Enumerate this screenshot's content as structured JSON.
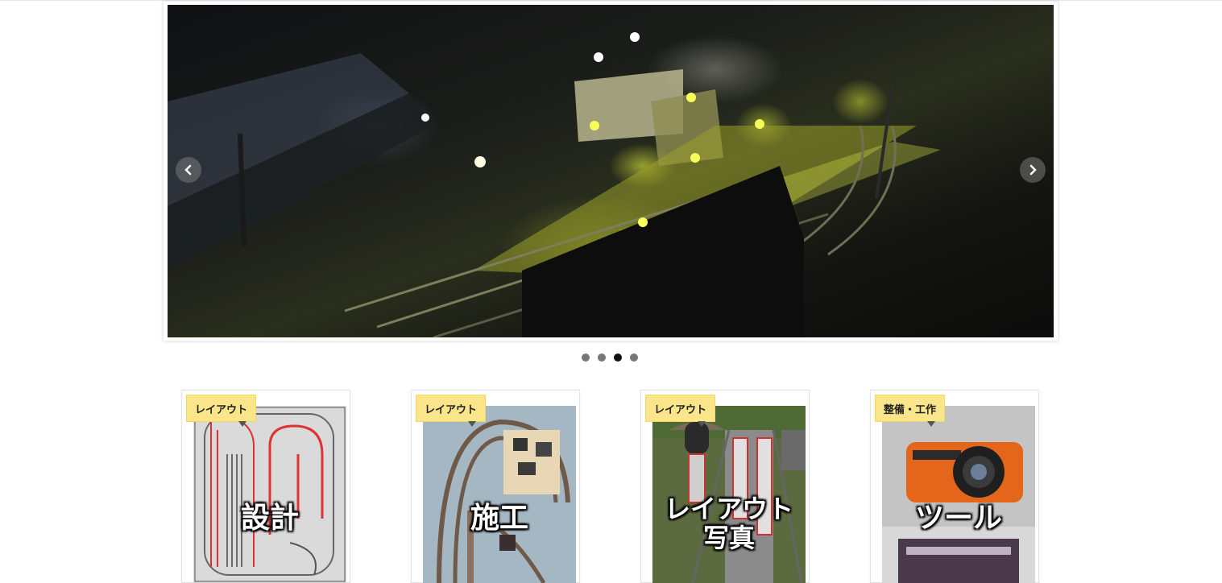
{
  "slider": {
    "prev_icon": "chevron-left-icon",
    "next_icon": "chevron-right-icon",
    "dots": [
      {
        "active": false
      },
      {
        "active": false
      },
      {
        "active": true
      },
      {
        "active": false
      }
    ]
  },
  "cards": [
    {
      "tag": "レイアウト",
      "title": "設計"
    },
    {
      "tag": "レイアウト",
      "title": "施工"
    },
    {
      "tag": "レイアウト",
      "title_line1": "レイアウト",
      "title_line2": "写真"
    },
    {
      "tag": "整備・工作",
      "title": "ツール"
    }
  ]
}
